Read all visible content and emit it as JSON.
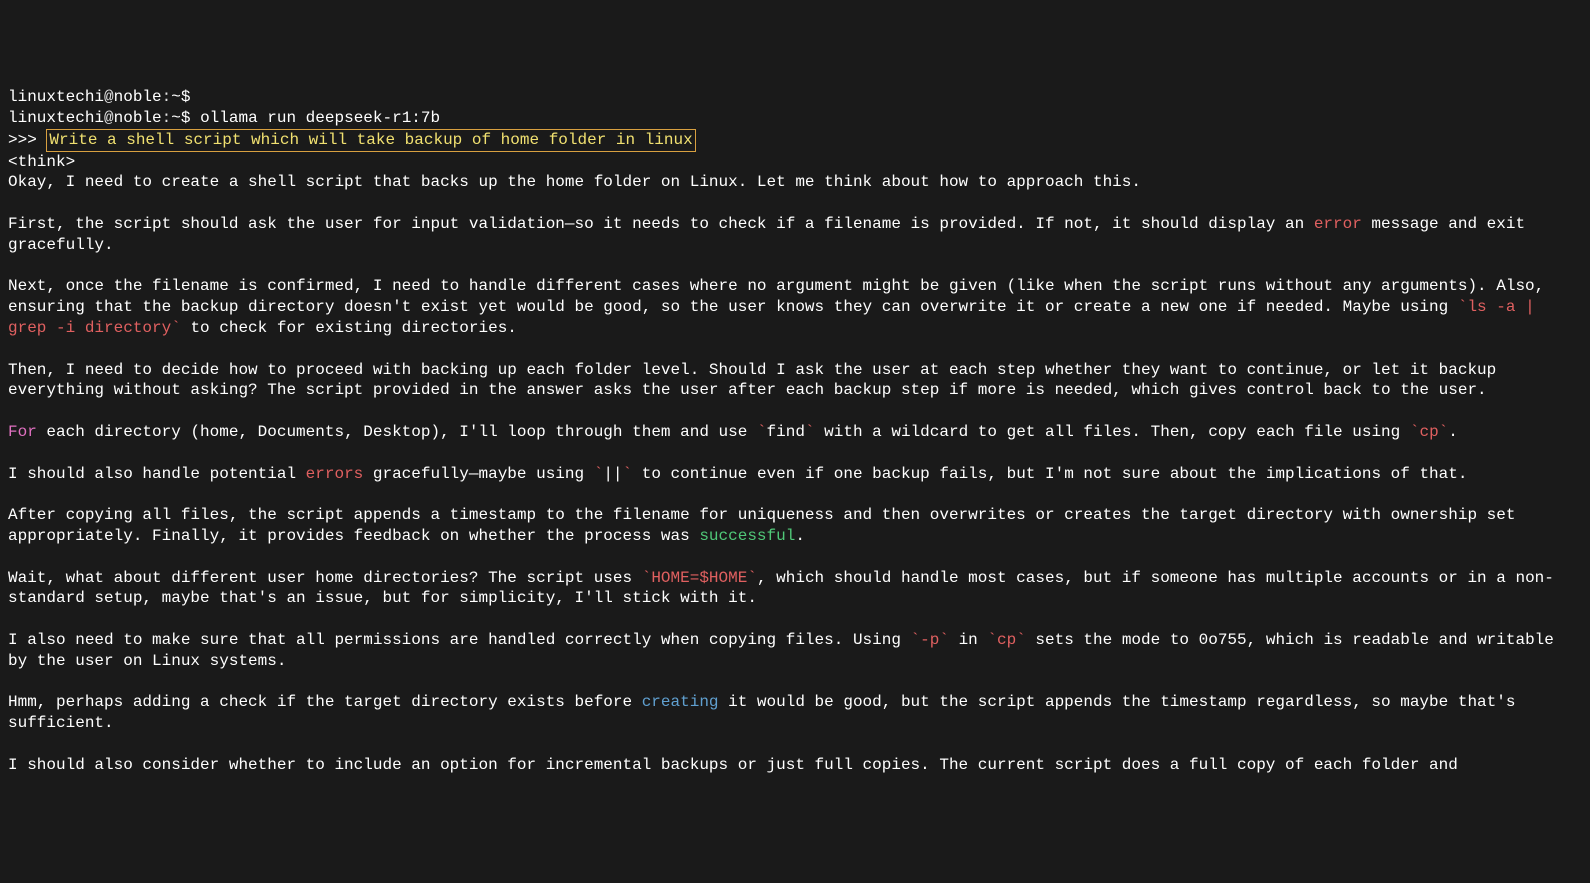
{
  "terminal": {
    "line1": {
      "user": "linuxtechi",
      "at": "@",
      "host": "noble",
      "colon": ":",
      "path": "~",
      "dollar": "$"
    },
    "line2": {
      "user": "linuxtechi",
      "at": "@",
      "host": "noble",
      "colon": ":",
      "path": "~",
      "dollar": "$ ",
      "command": "ollama run deepseek-r1:7b"
    },
    "line3": {
      "prompt": ">>> ",
      "input": "Write a shell script which will take backup of home folder in linux"
    },
    "think_open": "<think>",
    "para1": "Okay, I need to create a shell script that backs up the home folder on Linux. Let me think about how to approach this.",
    "para2a": "First, the script should ask the user for input validation—so it needs to check if a filename is provided. If not, it should display an ",
    "para2_error": "error",
    "para2b": " message and exit gracefully.",
    "para3a": "Next, once the filename is confirmed, I need to handle different cases where no argument might be given (like when the script runs without any arguments). Also, ensuring that the backup directory doesn't exist yet would be good, so the user knows they can overwrite it or create a new one if needed. Maybe using ",
    "para3_code_tick1": "`",
    "para3_code": "ls -a | grep -i directory",
    "para3_code_tick2": "`",
    "para3b": " to check for existing directories.",
    "para4": "Then, I need to decide how to proceed with backing up each folder level. Should I ask the user at each step whether they want to continue, or let it backup everything without asking? The script provided in the answer asks the user after each backup step if more is needed, which gives control back to the user.",
    "para5_for": "For",
    "para5a": " each directory (home, Documents, Desktop), I'll loop through them and use ",
    "para5_tick1": "`",
    "para5_find": "find",
    "para5_tick2": "`",
    "para5b": " with a wildcard to get all files. Then, copy each file using ",
    "para5_tick3": "`",
    "para5_cp": "cp",
    "para5_tick4": "`",
    "para5c": ".",
    "para6a": "I should also handle potential ",
    "para6_errors": "errors",
    "para6b": " gracefully—maybe using ",
    "para6_tick1": "`",
    "para6_or": "||",
    "para6_tick2": "`",
    "para6c": " to continue even if one backup fails, but I'm not sure about the implications of that.",
    "para7a": "After copying all files, the script appends a timestamp to the filename for uniqueness and then overwrites or creates the target directory with ownership set appropriately. Finally, it provides feedback on whether the process was ",
    "para7_success": "successful",
    "para7b": ".",
    "para8a": "Wait, what about different user home directories? The script uses ",
    "para8_tick1": "`",
    "para8_home": "HOME=$HOME",
    "para8_tick2": "`",
    "para8b": ", which should handle most cases, but if someone has multiple accounts or in a non-standard setup, maybe that's an issue, but for simplicity, I'll stick with it.",
    "para9a": "I also need to make sure that all permissions are handled correctly when copying files. Using ",
    "para9_tick1": "`",
    "para9_flag": "-p",
    "para9_tick2": "`",
    "para9b": " in ",
    "para9_tick3": "`",
    "para9_cp": "cp",
    "para9_tick4": "`",
    "para9c": " sets the mode to 0o755, which is readable and writable by the user on Linux systems.",
    "para10a": "Hmm, perhaps adding a check if the target directory exists before ",
    "para10_creating": "creating",
    "para10b": " it would be good, but the script appends the timestamp regardless, so maybe that's sufficient.",
    "para11": "I should also consider whether to include an option for incremental backups or just full copies. The current script does a full copy of each folder and "
  }
}
